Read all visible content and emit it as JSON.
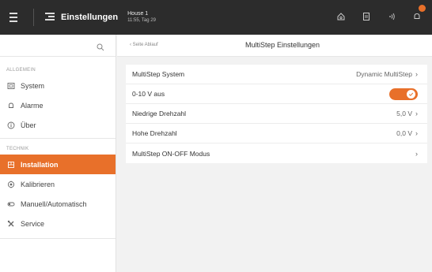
{
  "topbar": {
    "app_title": "Einstellungen",
    "house_name": "House 1",
    "house_time": "11:55, Tag 29",
    "notification_count": ""
  },
  "sidebar": {
    "sections": [
      {
        "label": "ALLGEMEIN",
        "items": [
          {
            "label": "System",
            "icon": "system-icon"
          },
          {
            "label": "Alarme",
            "icon": "bell-icon"
          },
          {
            "label": "Über",
            "icon": "info-icon"
          }
        ]
      },
      {
        "label": "TECHNIK",
        "items": [
          {
            "label": "Installation",
            "icon": "installation-icon",
            "active": true
          },
          {
            "label": "Kalibrieren",
            "icon": "calibrate-icon"
          },
          {
            "label": "Manuell/Automatisch",
            "icon": "manual-auto-icon"
          },
          {
            "label": "Service",
            "icon": "service-icon"
          }
        ]
      }
    ]
  },
  "subheader": {
    "back_label": "‹ Seite Ablauf",
    "title": "MultiStep Einstellungen"
  },
  "settings": {
    "rows": [
      {
        "label": "MultiStep System",
        "value": "Dynamic MultiStep",
        "chevron": "›"
      },
      {
        "label": "0-10 V aus",
        "toggle": true
      },
      {
        "label": "Niedrige Drehzahl",
        "value": "5,0 V",
        "chevron": "›"
      },
      {
        "label": "Hohe Drehzahl",
        "value": "0,0 V",
        "chevron": "›"
      },
      {
        "label": "MultiStep ON-OFF Modus",
        "value": "",
        "chevron": "›"
      }
    ]
  },
  "colors": {
    "accent": "#e8702a",
    "topbar": "#2c2c2c",
    "background": "#f2f2f2"
  }
}
